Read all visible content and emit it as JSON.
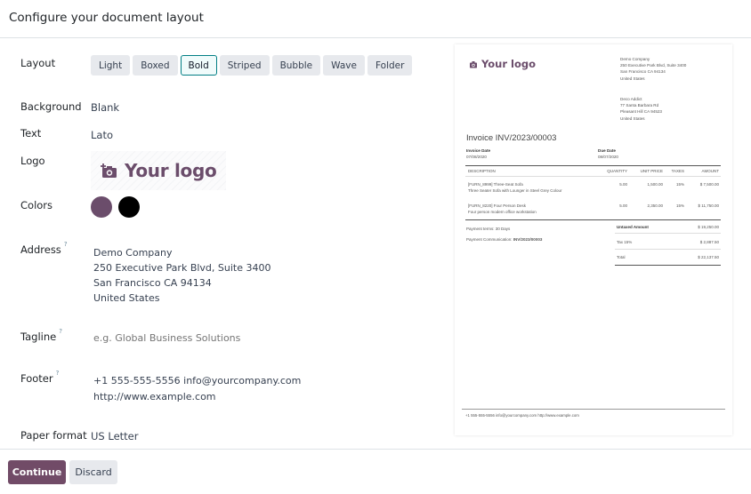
{
  "dialog": {
    "title": "Configure your document layout"
  },
  "form": {
    "layout": {
      "label": "Layout",
      "options": [
        "Light",
        "Boxed",
        "Bold",
        "Striped",
        "Bubble",
        "Wave",
        "Folder"
      ],
      "selected": "Bold"
    },
    "background": {
      "label": "Background",
      "value": "Blank"
    },
    "text": {
      "label": "Text",
      "value": "Lato"
    },
    "logo": {
      "label": "Logo",
      "value": "Your logo",
      "icon": "camera-plus-icon"
    },
    "colors": {
      "label": "Colors",
      "primary": "#6b4d6b",
      "secondary": "#000000"
    },
    "address": {
      "label": "Address",
      "help": "?",
      "lines": [
        "Demo Company",
        "250 Executive Park Blvd, Suite 3400",
        "San Francisco CA 94134",
        "United States"
      ]
    },
    "tagline": {
      "label": "Tagline",
      "help": "?",
      "placeholder": "e.g. Global Business Solutions",
      "value": ""
    },
    "footer": {
      "label": "Footer",
      "help": "?",
      "lines": [
        "+1 555-555-5556 info@yourcompany.com",
        "http://www.example.com"
      ]
    },
    "paper_format": {
      "label": "Paper format",
      "value": "US Letter"
    }
  },
  "actions": {
    "continue_label": "Continue",
    "discard_label": "Discard",
    "accent": "#714b67"
  },
  "preview": {
    "logo_text": "Your logo",
    "company_address": [
      "Demo Company",
      "250 Executive Park Blvd, Suite 3400",
      "San Francisco CA 94134",
      "United States"
    ],
    "customer_address": [
      "Deco Addict",
      "77 Santa Barbara Rd",
      "Pleasant Hill CA 94523",
      "United States"
    ],
    "invoice_title": "Invoice INV/2023/00003",
    "invoice_date_label": "Invoice Date",
    "invoice_date": "07/08/2020",
    "due_date_label": "Due Date",
    "due_date": "08/07/2020",
    "columns": [
      "DESCRIPTION",
      "QUANTITY",
      "UNIT PRICE",
      "TAXES",
      "AMOUNT"
    ],
    "lines": [
      {
        "name": "[FURN_8999] Three-Seat Sofa",
        "desc": "Three Seater Sofa with Lounger in Steel Grey Colour",
        "qty": "5.00",
        "price": "1,500.00",
        "tax": "15%",
        "amount": "$ 7,500.00"
      },
      {
        "name": "[FURN_8220] Four Person Desk",
        "desc": "Four person modern office workstation",
        "qty": "5.00",
        "price": "2,350.00",
        "tax": "15%",
        "amount": "$ 11,750.00"
      }
    ],
    "payment_terms": "Payment terms: 30 Days",
    "payment_communication_label": "Payment Communication:",
    "payment_communication": "INV/2023/00003",
    "totals": [
      {
        "label": "Untaxed Amount",
        "value": "$ 19,250.00"
      },
      {
        "label": "Tax 15%",
        "value": "$ 2,887.50"
      },
      {
        "label": "Total",
        "value": "$ 22,137.50"
      }
    ],
    "footer": "+1 555-555-5556 info@yourcompany.com http://www.example.com"
  }
}
